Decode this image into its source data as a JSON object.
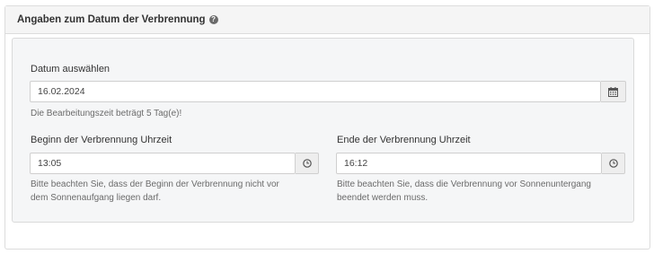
{
  "panel": {
    "title": "Angaben zum Datum der Verbrennung",
    "help_icon": "question-circle-icon"
  },
  "date": {
    "label": "Datum auswählen",
    "value": "16.02.2024",
    "icon": "calendar-icon",
    "help": "Die Bearbeitungszeit beträgt 5 Tag(e)!"
  },
  "start": {
    "label": "Beginn der Verbrennung Uhrzeit",
    "value": "13:05",
    "icon": "clock-icon",
    "help_line1": "Bitte beachten Sie, dass der Beginn der Verbrennung nicht vor",
    "help_line2": "dem Sonnenaufgang liegen darf."
  },
  "end": {
    "label": "Ende der Verbrennung Uhrzeit",
    "value": "16:12",
    "icon": "clock-icon",
    "help_line1": "Bitte beachten Sie, dass die Verbrennung vor Sonnenuntergang",
    "help_line2": "beendet werden muss."
  }
}
